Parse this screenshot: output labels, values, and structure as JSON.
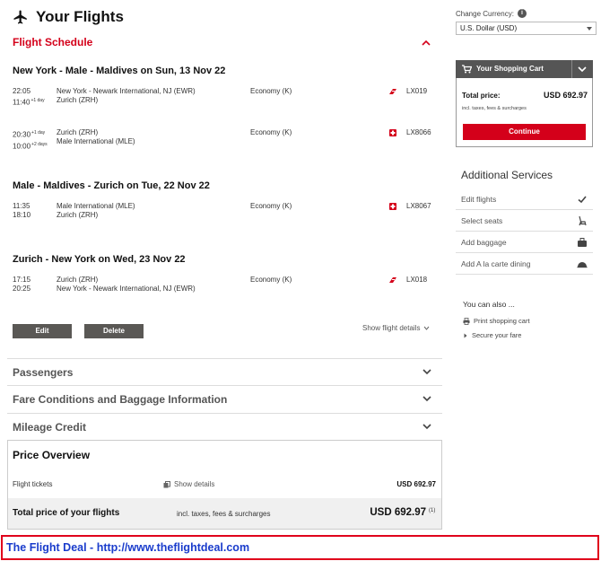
{
  "header": {
    "title": "Your Flights"
  },
  "schedule": {
    "title": "Flight Schedule",
    "legs": [
      {
        "title": "New York - Male - Maldives on Sun, 13 Nov 22",
        "segments": [
          {
            "dep_time": "22:05",
            "dep_offset": "",
            "arr_time": "11:40",
            "arr_offset": "+1 day",
            "from": "New York - Newark International, NJ (EWR)",
            "to": "Zurich (ZRH)",
            "cabin": "Economy (K)",
            "flight": "LX019"
          },
          {
            "dep_time": "20:30",
            "dep_offset": "+1 day",
            "arr_time": "10:00",
            "arr_offset": "+2 days",
            "from": "Zurich (ZRH)",
            "to": "Male International (MLE)",
            "cabin": "Economy (K)",
            "flight": "LX8066"
          }
        ]
      },
      {
        "title": "Male - Maldives - Zurich on Tue, 22 Nov 22",
        "segments": [
          {
            "dep_time": "11:35",
            "dep_offset": "",
            "arr_time": "18:10",
            "arr_offset": "",
            "from": "Male International (MLE)",
            "to": "Zurich (ZRH)",
            "cabin": "Economy (K)",
            "flight": "LX8067"
          }
        ]
      },
      {
        "title": "Zurich - New York on Wed, 23 Nov 22",
        "segments": [
          {
            "dep_time": "17:15",
            "dep_offset": "",
            "arr_time": "20:25",
            "arr_offset": "",
            "from": "Zurich (ZRH)",
            "to": "New York - Newark International, NJ (EWR)",
            "cabin": "Economy (K)",
            "flight": "LX018"
          }
        ]
      }
    ],
    "edit_label": "Edit",
    "delete_label": "Delete",
    "show_flight_details": "Show flight details"
  },
  "sections": {
    "passengers": "Passengers",
    "fare_conditions": "Fare Conditions and Baggage Information",
    "mileage": "Mileage Credit"
  },
  "price": {
    "title": "Price Overview",
    "flight_tickets_label": "Flight tickets",
    "show_details": "Show details",
    "flight_tickets_value": "USD 692.97",
    "total_label": "Total price of your flights",
    "total_incl": "incl. taxes, fees & surcharges",
    "total_value": "USD 692.97",
    "total_note": "(1)"
  },
  "currency": {
    "label": "Change Currency:",
    "info": "i",
    "selected": "U.S. Dollar (USD)"
  },
  "cart": {
    "title": "Your Shopping Cart",
    "total_label": "Total price:",
    "total_value": "USD 692.97",
    "incl": "incl. taxes, fees & surcharges",
    "continue": "Continue"
  },
  "services": {
    "title": "Additional Services",
    "items": [
      {
        "label": "Edit flights",
        "icon": "checkmark-icon"
      },
      {
        "label": "Select seats",
        "icon": "seat-icon"
      },
      {
        "label": "Add baggage",
        "icon": "baggage-icon"
      },
      {
        "label": "Add A la carte dining",
        "icon": "dining-cloche-icon"
      }
    ]
  },
  "also": {
    "title": "You can also ...",
    "print": "Print shopping cart",
    "secure": "Secure your fare"
  },
  "banner": {
    "text": "The Flight Deal - http://www.theflightdeal.com"
  },
  "colors": {
    "accent": "#d4001a",
    "dark_button": "#5a5855",
    "banner_text": "#1a3ccc"
  }
}
